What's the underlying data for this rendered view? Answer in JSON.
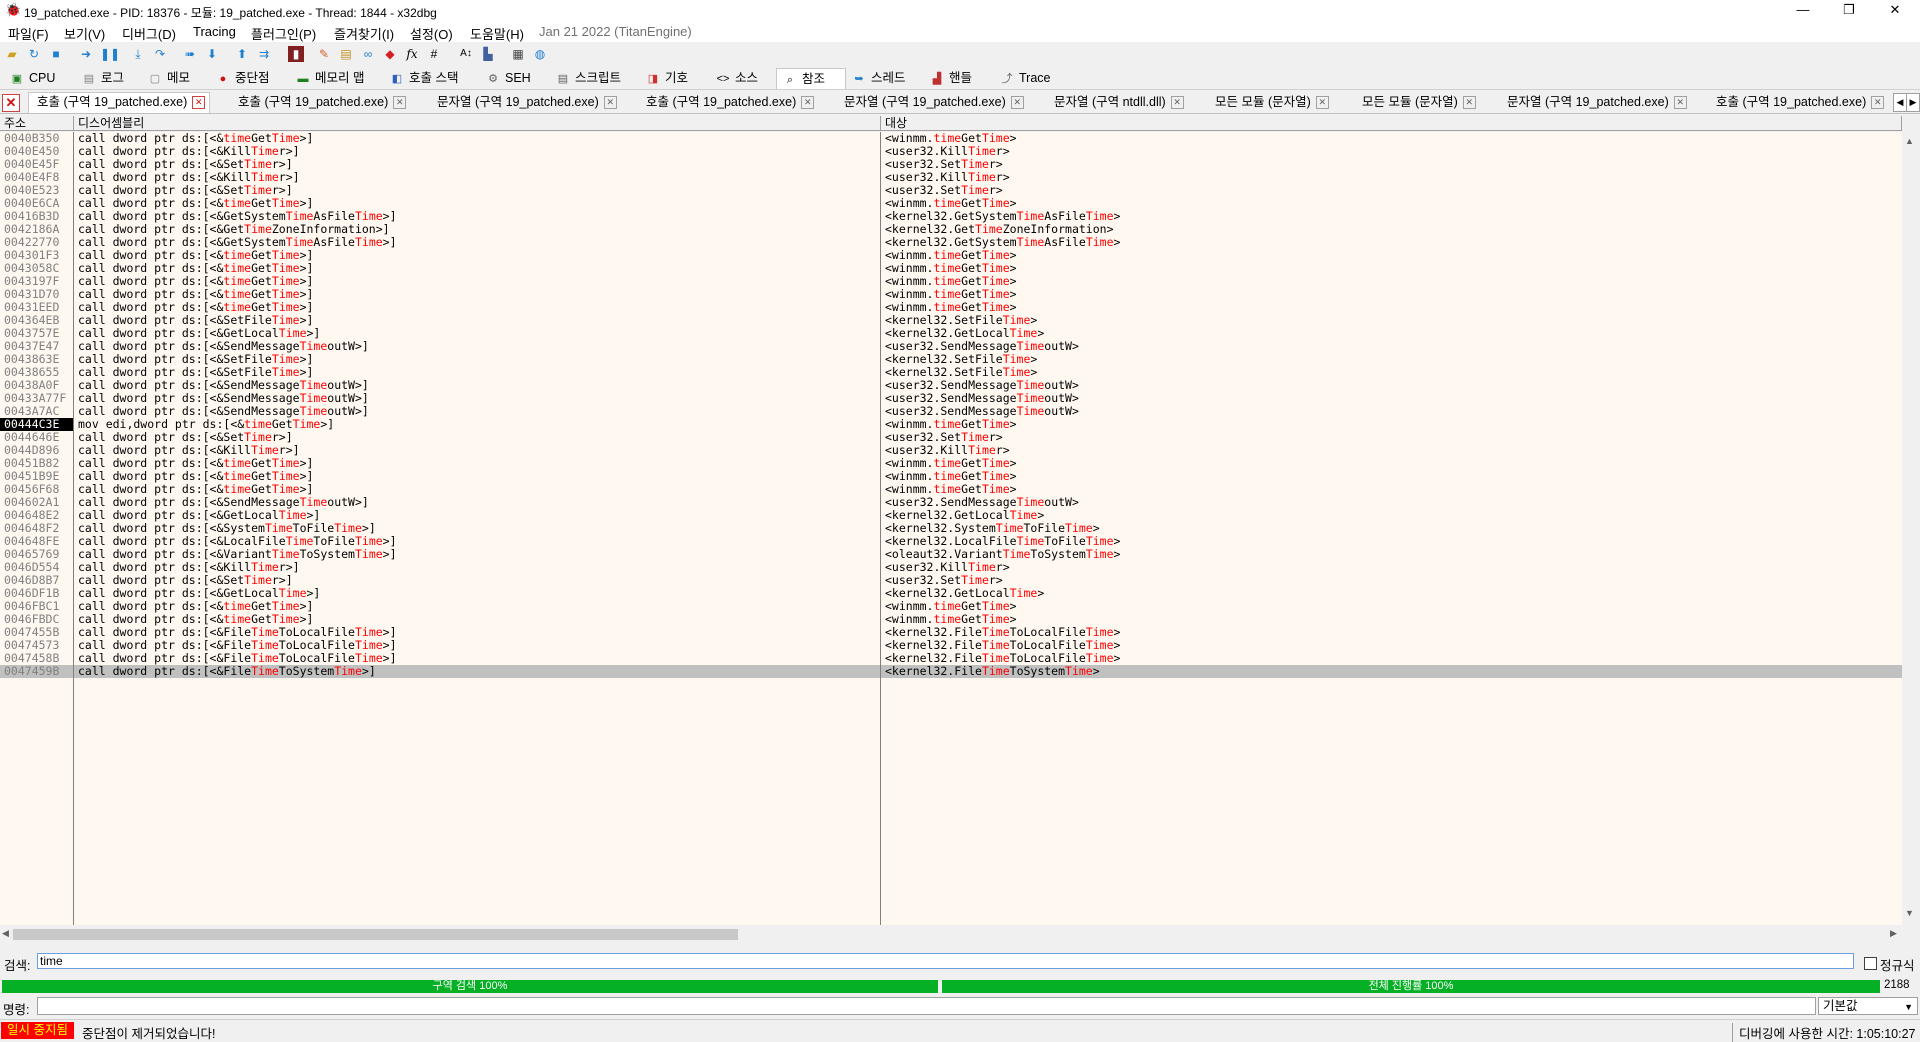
{
  "window": {
    "title": "19_patched.exe - PID: 18376 - 모듈: 19_patched.exe - Thread: 1844 - x32dbg",
    "minimize": "—",
    "maximize": "❐",
    "close": "✕"
  },
  "menu": {
    "items": [
      "파일(F)",
      "보기(V)",
      "디버그(D)",
      "Tracing",
      "플러그인(P)",
      "즐겨찾기(I)",
      "설정(O)",
      "도움말(H)"
    ],
    "build": "Jan 21 2022 (TitanEngine)"
  },
  "toolbar": {
    "icons": [
      "open-folder",
      "restart",
      "stop",
      "run",
      "pause",
      "step-into",
      "step-over",
      "run-to-user",
      "step-out",
      "animate",
      "trace-into",
      "trace-over",
      "execute-till-return",
      "patch",
      "comment",
      "label",
      "bookmark",
      "function",
      "hash",
      "font",
      "module",
      "calc",
      "globe"
    ]
  },
  "view_tabs": [
    {
      "label": "CPU",
      "icon": "cpu-icon"
    },
    {
      "label": "로그",
      "icon": "log-icon"
    },
    {
      "label": "메모",
      "icon": "notes-icon"
    },
    {
      "label": "중단점",
      "icon": "breakpoint-icon"
    },
    {
      "label": "메모리 맵",
      "icon": "memory-map-icon"
    },
    {
      "label": "호출 스택",
      "icon": "call-stack-icon"
    },
    {
      "label": "SEH",
      "icon": "seh-icon"
    },
    {
      "label": "스크립트",
      "icon": "script-icon"
    },
    {
      "label": "기호",
      "icon": "symbols-icon"
    },
    {
      "label": "소스",
      "icon": "source-icon"
    },
    {
      "label": "참조",
      "icon": "references-icon"
    },
    {
      "label": "스레드",
      "icon": "threads-icon"
    },
    {
      "label": "핸들",
      "icon": "handles-icon"
    },
    {
      "label": "Trace",
      "icon": "trace-icon"
    }
  ],
  "sub_tabs": [
    "호출 (구역 19_patched.exe)",
    "호출 (구역 19_patched.exe)",
    "문자열 (구역 19_patched.exe)",
    "호출 (구역 19_patched.exe)",
    "문자열 (구역 19_patched.exe)",
    "문자열 (구역 ntdll.dll)",
    "모든 모듈 (문자열)",
    "모든 모듈 (문자열)",
    "문자열 (구역 19_patched.exe)",
    "호출 (구역 19_patched.exe)"
  ],
  "columns": {
    "address": "주소",
    "disassembly": "디스어셈블리",
    "destination": "대상"
  },
  "rows": [
    {
      "addr": "0040B350",
      "dis": "call dword ptr ds:[<&timeGetTime>]",
      "dest": "<winmm.timeGetTime>"
    },
    {
      "addr": "0040E450",
      "dis": "call dword ptr ds:[<&KillTimer>]",
      "dest": "<user32.KillTimer>"
    },
    {
      "addr": "0040E45F",
      "dis": "call dword ptr ds:[<&SetTimer>]",
      "dest": "<user32.SetTimer>"
    },
    {
      "addr": "0040E4F8",
      "dis": "call dword ptr ds:[<&KillTimer>]",
      "dest": "<user32.KillTimer>"
    },
    {
      "addr": "0040E523",
      "dis": "call dword ptr ds:[<&SetTimer>]",
      "dest": "<user32.SetTimer>"
    },
    {
      "addr": "0040E6CA",
      "dis": "call dword ptr ds:[<&timeGetTime>]",
      "dest": "<winmm.timeGetTime>"
    },
    {
      "addr": "00416B3D",
      "dis": "call dword ptr ds:[<&GetSystemTimeAsFileTime>]",
      "dest": "<kernel32.GetSystemTimeAsFileTime>"
    },
    {
      "addr": "0042186A",
      "dis": "call dword ptr ds:[<&GetTimeZoneInformation>]",
      "dest": "<kernel32.GetTimeZoneInformation>"
    },
    {
      "addr": "00422770",
      "dis": "call dword ptr ds:[<&GetSystemTimeAsFileTime>]",
      "dest": "<kernel32.GetSystemTimeAsFileTime>"
    },
    {
      "addr": "004301F3",
      "dis": "call dword ptr ds:[<&timeGetTime>]",
      "dest": "<winmm.timeGetTime>"
    },
    {
      "addr": "0043058C",
      "dis": "call dword ptr ds:[<&timeGetTime>]",
      "dest": "<winmm.timeGetTime>"
    },
    {
      "addr": "0043197F",
      "dis": "call dword ptr ds:[<&timeGetTime>]",
      "dest": "<winmm.timeGetTime>"
    },
    {
      "addr": "00431D70",
      "dis": "call dword ptr ds:[<&timeGetTime>]",
      "dest": "<winmm.timeGetTime>"
    },
    {
      "addr": "00431EED",
      "dis": "call dword ptr ds:[<&timeGetTime>]",
      "dest": "<winmm.timeGetTime>"
    },
    {
      "addr": "004364EB",
      "dis": "call dword ptr ds:[<&SetFileTime>]",
      "dest": "<kernel32.SetFileTime>"
    },
    {
      "addr": "0043757E",
      "dis": "call dword ptr ds:[<&GetLocalTime>]",
      "dest": "<kernel32.GetLocalTime>"
    },
    {
      "addr": "00437E47",
      "dis": "call dword ptr ds:[<&SendMessageTimeoutW>]",
      "dest": "<user32.SendMessageTimeoutW>"
    },
    {
      "addr": "0043863E",
      "dis": "call dword ptr ds:[<&SetFileTime>]",
      "dest": "<kernel32.SetFileTime>"
    },
    {
      "addr": "00438655",
      "dis": "call dword ptr ds:[<&SetFileTime>]",
      "dest": "<kernel32.SetFileTime>"
    },
    {
      "addr": "00438A0F",
      "dis": "call dword ptr ds:[<&SendMessageTimeoutW>]",
      "dest": "<user32.SendMessageTimeoutW>"
    },
    {
      "addr": "00433A77F",
      "dis": "call dword ptr ds:[<&SendMessageTimeoutW>]",
      "dest": "<user32.SendMessageTimeoutW>"
    },
    {
      "addr": "0043A7AC",
      "dis": "call dword ptr ds:[<&SendMessageTimeoutW>]",
      "dest": "<user32.SendMessageTimeoutW>"
    },
    {
      "addr": "00444C3E",
      "dis": "mov edi,dword ptr ds:[<&timeGetTime>]",
      "dest": "<winmm.timeGetTime>",
      "hl": true
    },
    {
      "addr": "0044646E",
      "dis": "call dword ptr ds:[<&SetTimer>]",
      "dest": "<user32.SetTimer>"
    },
    {
      "addr": "0044D896",
      "dis": "call dword ptr ds:[<&KillTimer>]",
      "dest": "<user32.KillTimer>"
    },
    {
      "addr": "00451B82",
      "dis": "call dword ptr ds:[<&timeGetTime>]",
      "dest": "<winmm.timeGetTime>"
    },
    {
      "addr": "00451B9E",
      "dis": "call dword ptr ds:[<&timeGetTime>]",
      "dest": "<winmm.timeGetTime>"
    },
    {
      "addr": "00456F68",
      "dis": "call dword ptr ds:[<&timeGetTime>]",
      "dest": "<winmm.timeGetTime>"
    },
    {
      "addr": "004602A1",
      "dis": "call dword ptr ds:[<&SendMessageTimeoutW>]",
      "dest": "<user32.SendMessageTimeoutW>"
    },
    {
      "addr": "004648E2",
      "dis": "call dword ptr ds:[<&GetLocalTime>]",
      "dest": "<kernel32.GetLocalTime>"
    },
    {
      "addr": "004648F2",
      "dis": "call dword ptr ds:[<&SystemTimeToFileTime>]",
      "dest": "<kernel32.SystemTimeToFileTime>"
    },
    {
      "addr": "004648FE",
      "dis": "call dword ptr ds:[<&LocalFileTimeToFileTime>]",
      "dest": "<kernel32.LocalFileTimeToFileTime>"
    },
    {
      "addr": "00465769",
      "dis": "call dword ptr ds:[<&VariantTimeToSystemTime>]",
      "dest": "<oleaut32.VariantTimeToSystemTime>"
    },
    {
      "addr": "0046D554",
      "dis": "call dword ptr ds:[<&KillTimer>]",
      "dest": "<user32.KillTimer>"
    },
    {
      "addr": "0046D8B7",
      "dis": "call dword ptr ds:[<&SetTimer>]",
      "dest": "<user32.SetTimer>"
    },
    {
      "addr": "0046DF1B",
      "dis": "call dword ptr ds:[<&GetLocalTime>]",
      "dest": "<kernel32.GetLocalTime>"
    },
    {
      "addr": "0046FBC1",
      "dis": "call dword ptr ds:[<&timeGetTime>]",
      "dest": "<winmm.timeGetTime>"
    },
    {
      "addr": "0046FBDC",
      "dis": "call dword ptr ds:[<&timeGetTime>]",
      "dest": "<winmm.timeGetTime>"
    },
    {
      "addr": "0047455B",
      "dis": "call dword ptr ds:[<&FileTimeToLocalFileTime>]",
      "dest": "<kernel32.FileTimeToLocalFileTime>"
    },
    {
      "addr": "00474573",
      "dis": "call dword ptr ds:[<&FileTimeToLocalFileTime>]",
      "dest": "<kernel32.FileTimeToLocalFileTime>"
    },
    {
      "addr": "0047458B",
      "dis": "call dword ptr ds:[<&FileTimeToLocalFileTime>]",
      "dest": "<kernel32.FileTimeToLocalFileTime>"
    },
    {
      "addr": "0047459B",
      "dis": "call dword ptr ds:[<&FileTimeToSystemTime>]",
      "dest": "<kernel32.FileTimeToSystemTime>",
      "sel": true
    }
  ],
  "search": {
    "label": "검색:",
    "value": "time",
    "regex_label": "정규식",
    "regex_checked": false
  },
  "progress": {
    "region_label": "구역 검색 100%",
    "region_value": 100,
    "total_label": "전체 진행률 100%",
    "total_value": 100,
    "count": "2188"
  },
  "command": {
    "label": "명령:",
    "value": "",
    "mode": "기본값"
  },
  "status": {
    "state": "일시 중지됨",
    "message": "중단점이 제거되었습니다!",
    "time": "디버깅에 사용한 시간: 1:05:10:27"
  },
  "colors": {
    "highlight": "#ff0000",
    "grid_bg": "#fff8f0",
    "progress": "#06b025",
    "paused_bg": "#ff0000",
    "paused_fg": "#ffff00"
  }
}
